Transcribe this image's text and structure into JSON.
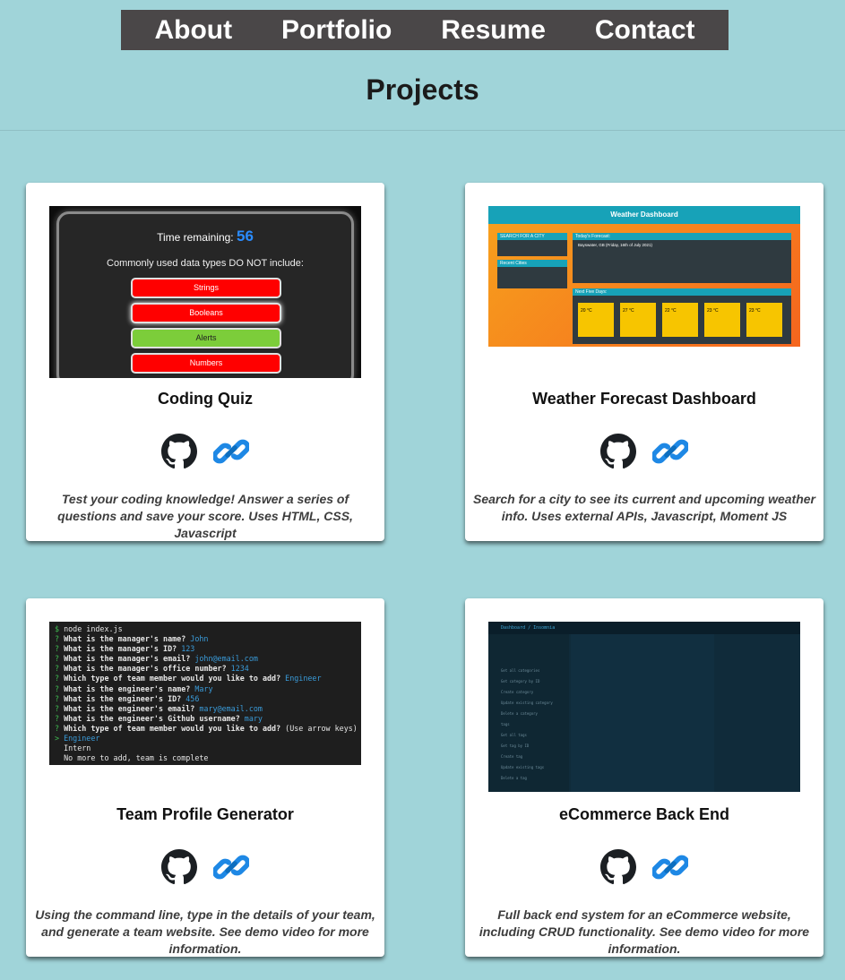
{
  "nav": {
    "items": [
      "About",
      "Portfolio",
      "Resume",
      "Contact"
    ]
  },
  "page_title": "Projects",
  "projects": [
    {
      "title": "Coding Quiz",
      "description": "Test your coding knowledge! Answer a series of questions and save your score. Uses HTML, CSS, Javascript",
      "github_icon": "github-icon",
      "link_icon": "link-icon",
      "screenshot": {
        "timer_label": "Time remaining:",
        "timer_value": "56",
        "question": "Commonly used data types DO NOT include:",
        "options": [
          "Strings",
          "Booleans",
          "Alerts",
          "Numbers"
        ]
      }
    },
    {
      "title": "Weather Forecast Dashboard",
      "description": "Search for a city to see its current and upcoming weather info. Uses external APIs, Javascript, Moment JS",
      "github_icon": "github-icon",
      "link_icon": "link-icon",
      "screenshot": {
        "header": "Weather Dashboard",
        "search_label": "SEARCH FOR A CITY",
        "recent_label": "Recent Cities",
        "today_label": "Today's Forecast:",
        "forecast_label": "Next Five Days:",
        "city_line": "Bayswater, GB (Friday, 16th of July 2021)",
        "temps": [
          "20 °C",
          "27 °C",
          "22 °C",
          "23 °C",
          "23 °C"
        ]
      }
    },
    {
      "title": "Team Profile Generator",
      "description": "Using the command line, type in the details of your team, and generate a team website. See demo video for more information.",
      "github_icon": "github-icon",
      "link_icon": "link-icon",
      "screenshot": {
        "lines": [
          {
            "p": "$ ",
            "q": "node index.js",
            "a": ""
          },
          {
            "p": "? ",
            "q": "What is the manager's name?",
            "a": " John"
          },
          {
            "p": "? ",
            "q": "What is the manager's ID?",
            "a": " 123"
          },
          {
            "p": "? ",
            "q": "What is the manager's email?",
            "a": " john@email.com"
          },
          {
            "p": "? ",
            "q": "What is the manager's office number?",
            "a": " 1234"
          },
          {
            "p": "? ",
            "q": "Which type of team member would you like to add?",
            "a": " Engineer"
          },
          {
            "p": "? ",
            "q": "What is the engineer's name?",
            "a": " Mary"
          },
          {
            "p": "? ",
            "q": "What is the engineer's ID?",
            "a": " 456"
          },
          {
            "p": "? ",
            "q": "What is the engineer's email?",
            "a": " mary@email.com"
          },
          {
            "p": "? ",
            "q": "What is the engineer's Github username?",
            "a": " mary"
          },
          {
            "p": "? ",
            "q": "Which type of team member would you like to add?",
            "a": " (Use arrow keys)"
          },
          {
            "p": "> ",
            "q": "",
            "a": "Engineer"
          },
          {
            "p": "  ",
            "q": "Intern",
            "a": ""
          },
          {
            "p": "  ",
            "q": "No more to add, team is complete",
            "a": ""
          }
        ]
      }
    },
    {
      "title": "eCommerce Back End",
      "description": "Full back end system for an eCommerce website, including CRUD functionality. See demo video for more information.",
      "github_icon": "github-icon",
      "link_icon": "link-icon",
      "screenshot": {
        "header": "Dashboard / Insomnia",
        "sidebar": [
          "Get all categories",
          "Get category by ID",
          "Create category",
          "Update existing category",
          "Delete a category",
          "tags",
          "Get all tags",
          "Get tag by ID",
          "Create tag",
          "Update existing tags",
          "Delete a tag"
        ]
      }
    }
  ],
  "colors": {
    "background": "#a0d4d9",
    "nav": "#4a4748",
    "link_icon": "#1e88e5"
  }
}
